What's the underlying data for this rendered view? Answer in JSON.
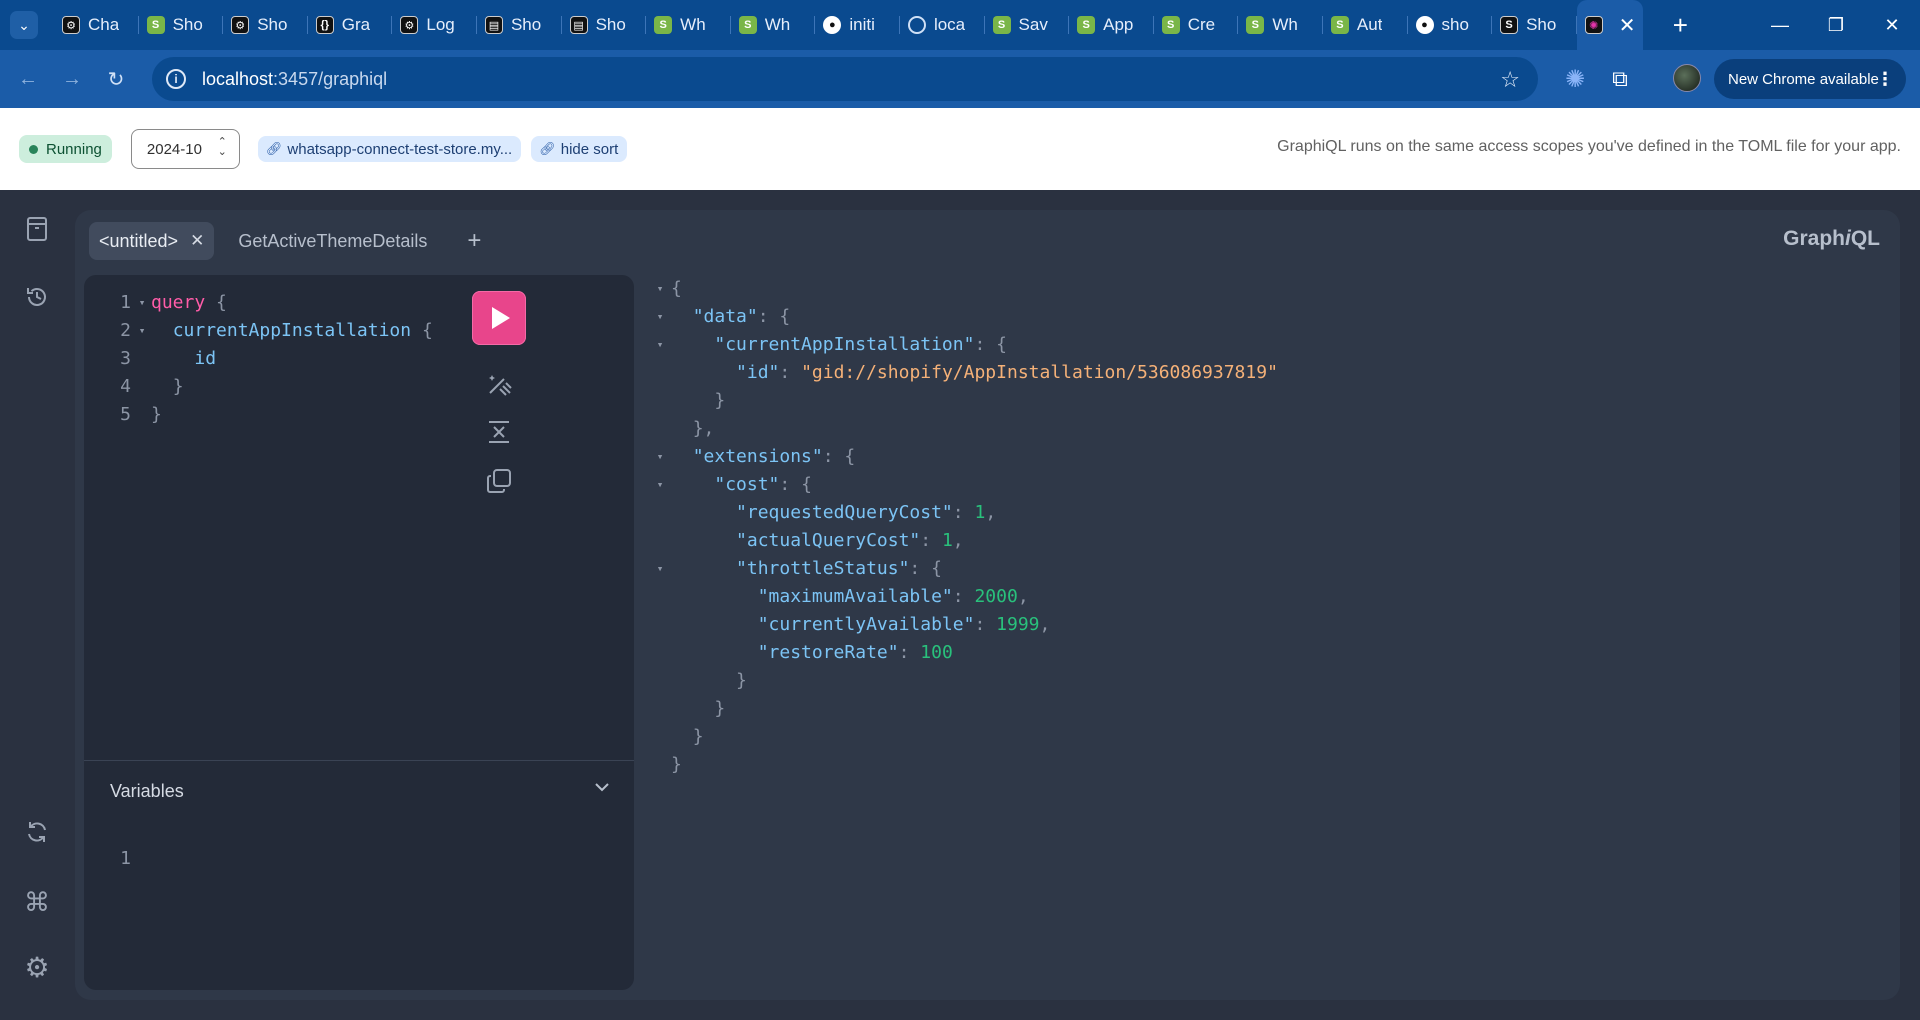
{
  "browser": {
    "tabs": [
      {
        "label": "Cha",
        "icon": "chatgpt-icon"
      },
      {
        "label": "Sho",
        "icon": "shopify-icon"
      },
      {
        "label": "Sho",
        "icon": "chatgpt-icon"
      },
      {
        "label": "Gra",
        "icon": "graphql-braces-icon"
      },
      {
        "label": "Log",
        "icon": "chatgpt-icon"
      },
      {
        "label": "Sho",
        "icon": "document-icon"
      },
      {
        "label": "Sho",
        "icon": "document-icon"
      },
      {
        "label": "Wh",
        "icon": "shopify-icon"
      },
      {
        "label": "Wh",
        "icon": "shopify-icon"
      },
      {
        "label": "initi",
        "icon": "github-icon"
      },
      {
        "label": "loca",
        "icon": "globe-icon"
      },
      {
        "label": "Sav",
        "icon": "shopify-icon"
      },
      {
        "label": "App",
        "icon": "shopify-app-icon"
      },
      {
        "label": "Cre",
        "icon": "shopify-icon"
      },
      {
        "label": "Wh",
        "icon": "shopify-icon"
      },
      {
        "label": "Aut",
        "icon": "shopify-icon"
      },
      {
        "label": "sho",
        "icon": "github-icon"
      },
      {
        "label": "Sho",
        "icon": "shopify-dark-icon"
      }
    ],
    "active_tab_icon": "graphiql-icon",
    "url_host": "localhost",
    "url_rest": ":3457/graphiql",
    "update_label": "New Chrome available"
  },
  "app_header": {
    "status": "Running",
    "api_version": "2024-10",
    "store_link": "whatsapp-connect-test-store.my...",
    "sort_link": "hide sort",
    "note": "GraphiQL runs on the same access scopes you've defined in the TOML file for your app."
  },
  "graphiql": {
    "brand_prefix": "Graph",
    "brand_italic": "i",
    "brand_suffix": "QL",
    "tabs": [
      {
        "label": "<untitled>",
        "active": true
      },
      {
        "label": "GetActiveThemeDetails",
        "active": false
      }
    ],
    "query_lines": [
      {
        "n": "1",
        "fold": "▾",
        "indent": "",
        "kw": "query",
        "field": "",
        "punc": " {"
      },
      {
        "n": "2",
        "fold": "▾",
        "indent": "  ",
        "kw": "",
        "field": "currentAppInstallation",
        "punc": " {"
      },
      {
        "n": "3",
        "fold": "",
        "indent": "    ",
        "kw": "",
        "field": "id",
        "punc": ""
      },
      {
        "n": "4",
        "fold": "",
        "indent": "  ",
        "kw": "",
        "field": "",
        "punc": "}"
      },
      {
        "n": "5",
        "fold": "",
        "indent": "",
        "kw": "",
        "field": "",
        "punc": "}"
      }
    ],
    "variables_label": "Variables",
    "variables_line_number": "1",
    "result_lines": [
      {
        "fold": "▾",
        "indent": "",
        "key": "",
        "sep": "",
        "value": "",
        "vtype": "",
        "tail": "{"
      },
      {
        "fold": "▾",
        "indent": "  ",
        "key": "\"data\"",
        "sep": ": ",
        "value": "",
        "vtype": "",
        "tail": "{"
      },
      {
        "fold": "▾",
        "indent": "    ",
        "key": "\"currentAppInstallation\"",
        "sep": ": ",
        "value": "",
        "vtype": "",
        "tail": "{"
      },
      {
        "fold": "",
        "indent": "      ",
        "key": "\"id\"",
        "sep": ": ",
        "value": "\"gid://shopify/AppInstallation/536086937819\"",
        "vtype": "str",
        "tail": ""
      },
      {
        "fold": "",
        "indent": "    ",
        "key": "",
        "sep": "",
        "value": "",
        "vtype": "",
        "tail": "}"
      },
      {
        "fold": "",
        "indent": "  ",
        "key": "",
        "sep": "",
        "value": "",
        "vtype": "",
        "tail": "},"
      },
      {
        "fold": "▾",
        "indent": "  ",
        "key": "\"extensions\"",
        "sep": ": ",
        "value": "",
        "vtype": "",
        "tail": "{"
      },
      {
        "fold": "▾",
        "indent": "    ",
        "key": "\"cost\"",
        "sep": ": ",
        "value": "",
        "vtype": "",
        "tail": "{"
      },
      {
        "fold": "",
        "indent": "      ",
        "key": "\"requestedQueryCost\"",
        "sep": ": ",
        "value": "1",
        "vtype": "num",
        "tail": ","
      },
      {
        "fold": "",
        "indent": "      ",
        "key": "\"actualQueryCost\"",
        "sep": ": ",
        "value": "1",
        "vtype": "num",
        "tail": ","
      },
      {
        "fold": "▾",
        "indent": "      ",
        "key": "\"throttleStatus\"",
        "sep": ": ",
        "value": "",
        "vtype": "",
        "tail": "{"
      },
      {
        "fold": "",
        "indent": "        ",
        "key": "\"maximumAvailable\"",
        "sep": ": ",
        "value": "2000",
        "vtype": "num",
        "tail": ","
      },
      {
        "fold": "",
        "indent": "        ",
        "key": "\"currentlyAvailable\"",
        "sep": ": ",
        "value": "1999",
        "vtype": "num",
        "tail": ","
      },
      {
        "fold": "",
        "indent": "        ",
        "key": "\"restoreRate\"",
        "sep": ": ",
        "value": "100",
        "vtype": "num",
        "tail": ""
      },
      {
        "fold": "",
        "indent": "      ",
        "key": "",
        "sep": "",
        "value": "",
        "vtype": "",
        "tail": "}"
      },
      {
        "fold": "",
        "indent": "    ",
        "key": "",
        "sep": "",
        "value": "",
        "vtype": "",
        "tail": "}"
      },
      {
        "fold": "",
        "indent": "  ",
        "key": "",
        "sep": "",
        "value": "",
        "vtype": "",
        "tail": "}"
      },
      {
        "fold": "",
        "indent": "",
        "key": "",
        "sep": "",
        "value": "",
        "vtype": "",
        "tail": "}"
      }
    ]
  },
  "colors": {
    "accent_run": "#e8458b",
    "status_running": "#cdeedd",
    "json_key": "#7cc4f5",
    "json_string": "#f5b178",
    "json_number": "#29c17c",
    "keyword": "#ff5ca8"
  }
}
